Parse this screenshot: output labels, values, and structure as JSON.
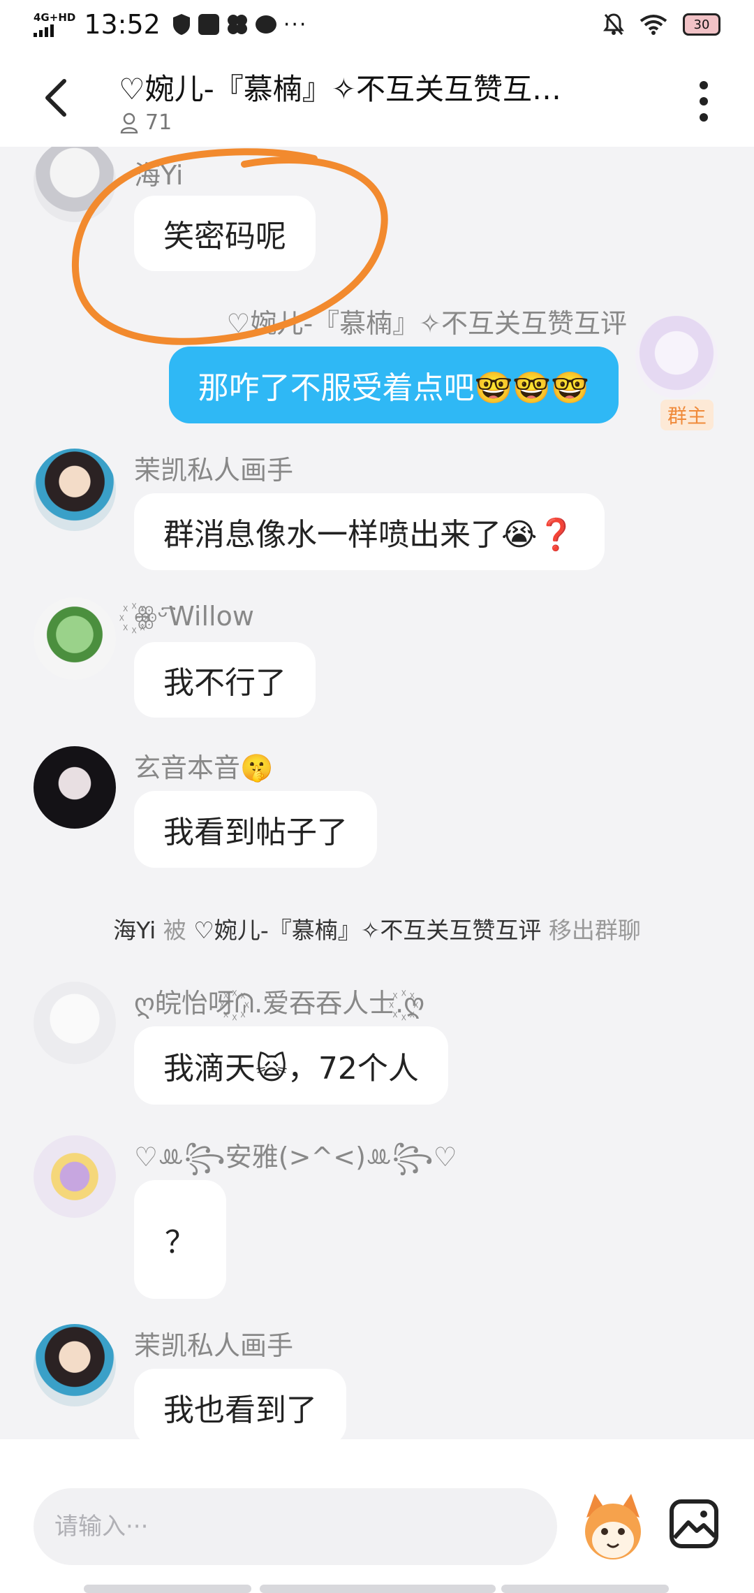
{
  "status_bar": {
    "network": "4G+HD",
    "time": "13:52",
    "battery": "30"
  },
  "header": {
    "title": "♡婉儿-『慕楠』✧不互关互赞互…",
    "member_count": "71"
  },
  "messages": [
    {
      "sender": "海Yi",
      "text": "笑密码呢"
    },
    {
      "sender": "♡婉儿-『慕楠』✧不互关互赞互评",
      "text": "那咋了不服受着点吧🤓🤓🤓",
      "badge": "群主"
    },
    {
      "sender": "茉凯私人画手",
      "text": "群消息像水一样喷出来了😭❓"
    },
    {
      "sender": "꙰ꙮ꙯ᵕ꙯Willow",
      "text": "我不行了"
    },
    {
      "sender": "玄音本音🤫",
      "text": "我看到帖子了"
    },
    {
      "sender": "ღ皖怡呀꙰ᕬ.爱吞吞人士.꙰ღ",
      "text": "我滴天🙀，72个人"
    },
    {
      "sender": "♡ꔛ꧂安雅(>^<)ꔛ꧂♡",
      "text": "？"
    },
    {
      "sender": "茉凯私人画手",
      "text": "我也看到了"
    }
  ],
  "system_notice": {
    "subject": "海Yi",
    "by": "被",
    "actor": "♡婉儿-『慕楠』✧不互关互赞互评",
    "action": "移出群聊"
  },
  "input": {
    "placeholder": "请输入···"
  },
  "colors": {
    "my_bubble": "#2fb8f5",
    "annotation": "#f28a2e",
    "owner_badge": "#f08a3a"
  },
  "icons": [
    "back-arrow-icon",
    "more-vertical-icon",
    "person-icon",
    "emoji-icon",
    "image-icon"
  ]
}
